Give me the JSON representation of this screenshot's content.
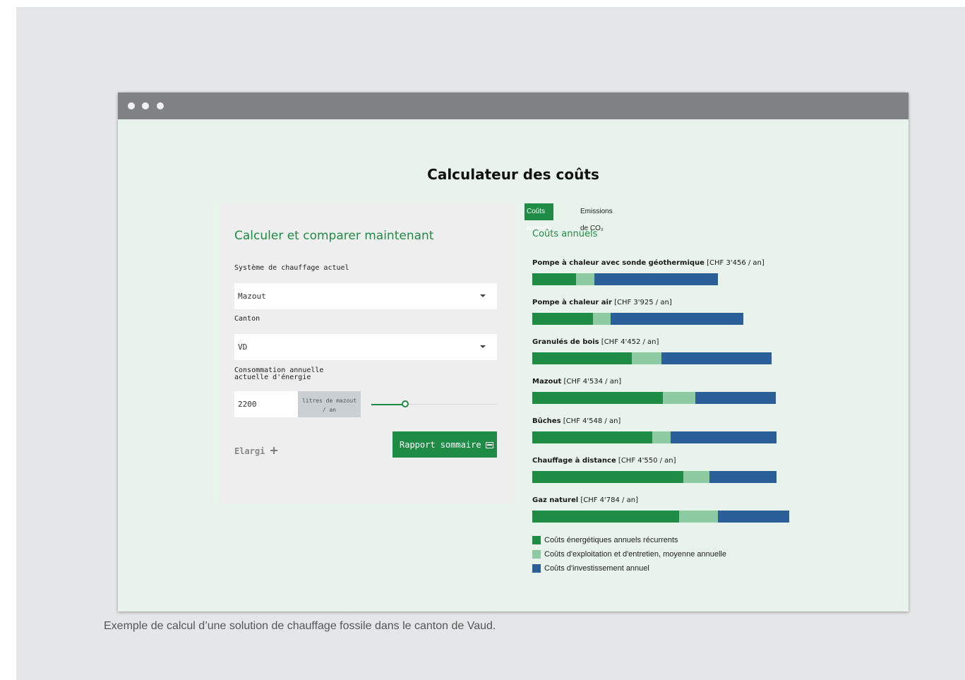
{
  "page": {
    "title": "Calculateur des coûts",
    "caption": "Exemple de calcul d’une solution de chauffage fossile dans le canton de Vaud."
  },
  "colors": {
    "accent": "#1e8c45",
    "energy": "#1e8c45",
    "maintenance": "#8dcaa2",
    "investment": "#2b5f98"
  },
  "form": {
    "heading": "Calculer et comparer maintenant",
    "system_label": "Système de chauffage actuel",
    "system_value": "Mazout",
    "canton_label": "Canton",
    "canton_value": "VD",
    "consumption_label": "Consommation annuelle actuelle d'énergie",
    "consumption_value": "2200",
    "unit_line1": "litres de mazout",
    "unit_line2": "/ an",
    "slider_fraction": 0.27,
    "elargi_label": "Elargi",
    "elargi_icon": "plus-icon",
    "report_label": "Rapport sommaire",
    "report_icon": "report-icon"
  },
  "tabs": {
    "active": "Coûts annuels",
    "inactive": "Emissions de CO₂"
  },
  "costs_heading": "Coûts annuels",
  "chart_data": {
    "type": "bar",
    "orientation": "horizontal",
    "stacked": true,
    "categories": [
      {
        "name": "Pompe à chaleur avec sonde géothermique",
        "detail": "[CHF 3'456 / an]"
      },
      {
        "name": "Pompe à chaleur air",
        "detail": "[CHF 3'925 / an]"
      },
      {
        "name": "Granulés de bois",
        "detail": "[CHF 4'452 / an]"
      },
      {
        "name": "Mazout",
        "detail": "[CHF 4'534 / an]"
      },
      {
        "name": "Bûches",
        "detail": "[CHF 4'548 / an]"
      },
      {
        "name": "Chauffage à distance",
        "detail": "[CHF 4'550 / an]"
      },
      {
        "name": "Gaz naturel",
        "detail": "[CHF 4'784 / an]"
      }
    ],
    "totals": [
      3456,
      3925,
      4452,
      4534,
      4548,
      4550,
      4784
    ],
    "series": [
      {
        "name": "Coûts énergétiques annuels récurrents",
        "color": "#1e8c45",
        "values": [
          820,
          1130,
          1850,
          2430,
          2240,
          2810,
          2730
        ]
      },
      {
        "name": "Coûts d'exploitation et d'entretien, moyenne annuelle",
        "color": "#8dcaa2",
        "values": [
          330,
          330,
          560,
          610,
          330,
          490,
          720
        ]
      },
      {
        "name": "Coûts d'investissement annuel",
        "color": "#2b5f98",
        "values": [
          2306,
          2465,
          2042,
          1494,
          1978,
          1250,
          1334
        ]
      }
    ],
    "legend_position": "bottom-left",
    "grid": false
  }
}
